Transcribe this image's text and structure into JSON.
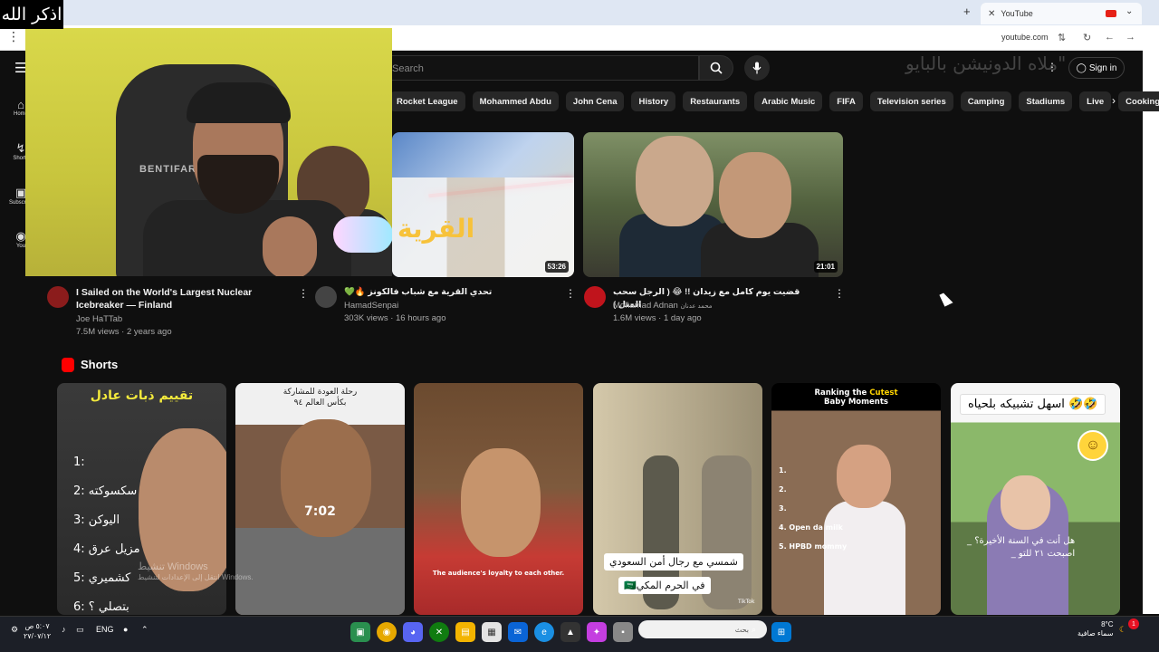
{
  "overlay": {
    "zikr": "اذكر الله",
    "banner": "ملاه الدونيشن بالبايو\""
  },
  "browser": {
    "tab_title": "YouTube",
    "url": "youtube.com",
    "new_tab": "+",
    "tab_close": "✕",
    "tab_chevron": "⌄",
    "menu_dots": "⋮"
  },
  "youtube": {
    "search_placeholder": "Search",
    "sign_in": "Sign in",
    "side_nav": [
      {
        "icon": "home-icon",
        "label": "Home"
      },
      {
        "icon": "shorts-icon",
        "label": "Shorts"
      },
      {
        "icon": "subscriptions-icon",
        "label": "Subscriptions"
      },
      {
        "icon": "you-icon",
        "label": "You"
      }
    ],
    "chips": [
      "Rocket League",
      "Mohammed Abdu",
      "John Cena",
      "History",
      "Restaurants",
      "Arabic Music",
      "FIFA",
      "Television series",
      "Camping",
      "Stadiums",
      "Live",
      "Cooking"
    ]
  },
  "webcam": {
    "chair_brand": "BENTIFAR"
  },
  "videos": [
    {
      "title": "I Sailed on the World's Largest Nuclear Icebreaker — Finland",
      "channel": "Joe HaTTab",
      "stats": "7.5M views · 2 years ago",
      "avatar_color": "#8b1c1c"
    },
    {
      "title": "💚🔥 تحدي القرية مع شباب فالكونز",
      "channel": "HamadSenpai",
      "stats": "303K views · 16 hours ago",
      "duration": "53:26",
      "thumb_text": "القرية",
      "avatar_color": "#444444"
    },
    {
      "title": "قضيت يوم كامل مع زيدان !! 😂 ( الرجل سحب المثل )",
      "channel": "Mohamad Adnan",
      "channel_alt": "محمد عدنان",
      "stats": "1.6M views · 1 day ago",
      "duration": "21:01",
      "avatar_color": "#c0141c"
    }
  ],
  "shorts": {
    "label": "Shorts",
    "items": [
      {
        "header": "تقييم ذبات عادل",
        "list": [
          "1:",
          "2: سكسوكته",
          "3: اليوكن",
          "4: مزيل عرق",
          "5: كشميري",
          "6: بتصلي ؟"
        ]
      },
      {
        "header_1": "رحلة العودة للمشاركة",
        "header_2": "بكأس العالم ٩٤",
        "time": "7:02"
      },
      {
        "subtitle": "The audience's loyalty to each other."
      },
      {
        "sub_1": "شمسي مع رجال أمن السعودي",
        "sub_2": "🇸🇦في الحرم المكي",
        "tiktok": "TikTok"
      },
      {
        "header_1": "Ranking the",
        "header_hl": "Cutest",
        "header_2": "Baby Moments",
        "list": [
          "1.",
          "2.",
          "3.",
          "4. Open da milk",
          "5. HPBD mommy"
        ]
      },
      {
        "header": "اسهل تشبيكه بلحياه 🤣🤣",
        "sub_1": "_ هل أنت في السنة الأخيرة؟",
        "sub_2": "_ اصبحت ٢١ للتو"
      }
    ]
  },
  "watermark": {
    "line_1": "تنشيط Windows",
    "line_2": "انتقل إلى الإعدادات لتنشيط Windows."
  },
  "taskbar": {
    "time": "٥:٠٧ ص",
    "date": "٢٧/٠٧/١٢",
    "lang": "ENG",
    "search_placeholder": "بحث",
    "temp": "8°C",
    "weather": "سماء صافية",
    "notif_count": "1"
  }
}
